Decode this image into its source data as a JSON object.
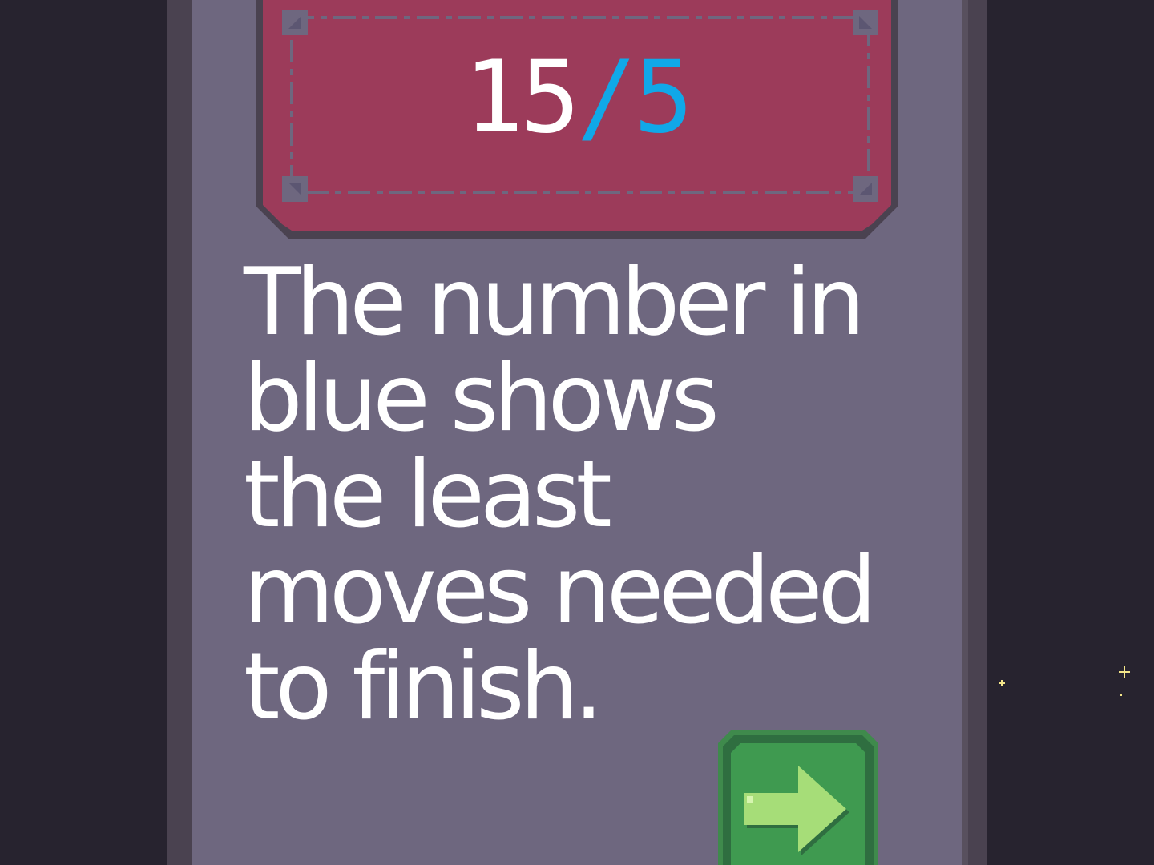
{
  "counter": {
    "current": "15",
    "separator": "/",
    "minimum": "5"
  },
  "tutorial": {
    "lines": [
      "The number in",
      "blue shows",
      "the least",
      "moves needed",
      "to finish."
    ]
  },
  "next_button": {
    "icon": "arrow-right-icon"
  },
  "colors": {
    "background": "#27232f",
    "panel": "#6e677f",
    "plate": "#9c3b5a",
    "accent_blue": "#10a8e8",
    "button_green": "#3f9a50",
    "arrow_green": "#a6dd78",
    "sparkle": "#f4e68a"
  }
}
